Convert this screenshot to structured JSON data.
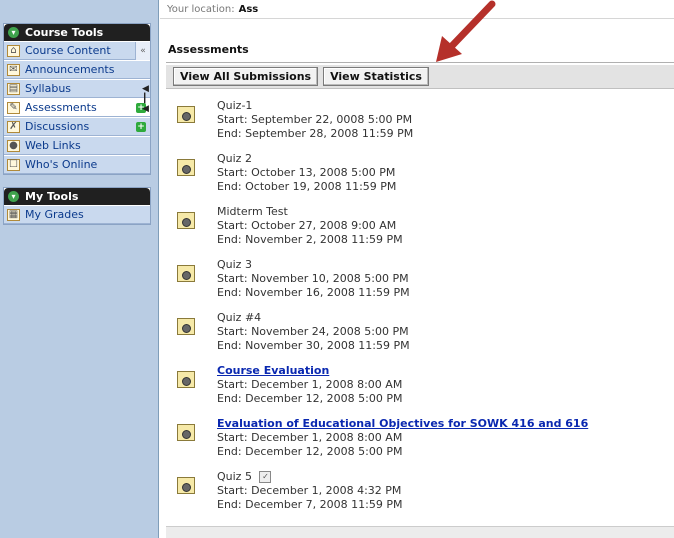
{
  "sidebar": {
    "course_tools_header": "Course Tools",
    "items": [
      {
        "label": "Course Content",
        "icon": "course-content-icon"
      },
      {
        "label": "Announcements",
        "icon": "announcements-icon"
      },
      {
        "label": "Syllabus",
        "icon": "syllabus-icon"
      },
      {
        "label": "Assessments",
        "icon": "assessments-icon",
        "active": true
      },
      {
        "label": "Discussions",
        "icon": "discussions-icon"
      },
      {
        "label": "Web Links",
        "icon": "web-links-icon"
      },
      {
        "label": "Who's Online",
        "icon": "whos-online-icon"
      }
    ],
    "my_tools_header": "My Tools",
    "my_items": [
      {
        "label": "My Grades",
        "icon": "my-grades-icon"
      }
    ]
  },
  "main": {
    "location_label": "Your location:",
    "location_value": "Ass",
    "page_title": "Assessments",
    "buttons": {
      "view_all_submissions": "View All Submissions",
      "view_statistics": "View Statistics"
    },
    "assessments": [
      {
        "name": "Quiz-1",
        "link": false,
        "start": "Start: September 22, 0008 5:00 PM",
        "end": "End: September 28, 2008 11:59 PM"
      },
      {
        "name": "Quiz 2",
        "link": false,
        "start": "Start: October 13, 2008 5:00 PM",
        "end": "End: October 19, 2008 11:59 PM"
      },
      {
        "name": "Midterm Test",
        "link": false,
        "start": "Start: October 27, 2008 9:00 AM",
        "end": "End: November 2, 2008 11:59 PM"
      },
      {
        "name": "Quiz 3",
        "link": false,
        "start": "Start: November 10, 2008 5:00 PM",
        "end": "End: November 16, 2008 11:59 PM"
      },
      {
        "name": "Quiz #4",
        "link": false,
        "start": "Start: November 24, 2008 5:00 PM",
        "end": "End: November 30, 2008 11:59 PM"
      },
      {
        "name": "Course Evaluation",
        "link": true,
        "start": "Start: December 1, 2008 8:00 AM",
        "end": "End: December 12, 2008 5:00 PM"
      },
      {
        "name": "Evaluation of Educational Objectives for SOWK 416 and 616",
        "link": true,
        "start": "Start: December 1, 2008 8:00 AM",
        "end": "End: December 12, 2008 5:00 PM"
      },
      {
        "name": "Quiz 5",
        "link": false,
        "start": "Start: December 1, 2008 4:32 PM",
        "end": "End: December 7, 2008 11:59 PM",
        "badge": true
      }
    ]
  },
  "colors": {
    "sidebar_bg": "#b9cce3",
    "header_bg": "#202020",
    "link": "#0a28b0",
    "arrow": "#c0392b"
  }
}
